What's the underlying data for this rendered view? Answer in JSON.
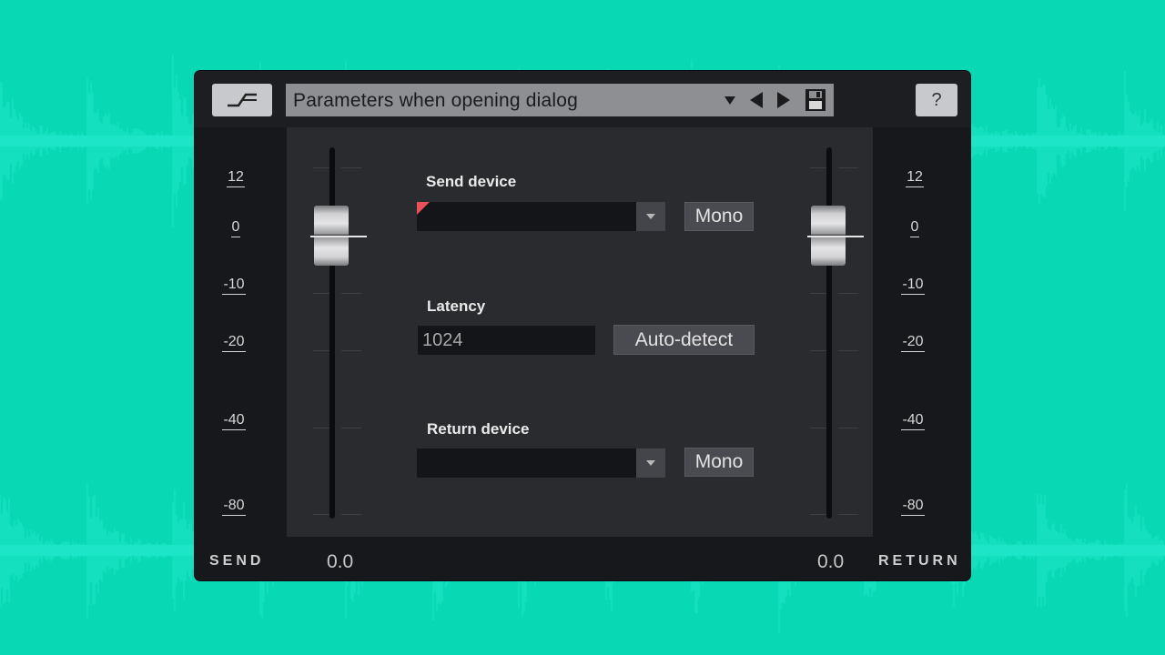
{
  "colors": {
    "background": "#08d8b4",
    "waveform": "#1de6c8",
    "panel": "#17181b",
    "center": "#2a2b2e"
  },
  "icons": {
    "bypass": "bypass-curve-icon",
    "preset_menu": "triangle-down-icon",
    "prev": "arrow-left-icon",
    "next": "arrow-right-icon",
    "save": "save-disk-icon"
  },
  "header": {
    "preset_name": "Parameters when opening dialog",
    "help_label": "?"
  },
  "send": {
    "label": "SEND",
    "value": "0.0",
    "scale": [
      "12",
      "0",
      "-10",
      "-20",
      "-40",
      "-80"
    ]
  },
  "return": {
    "label": "RETURN",
    "value": "0.0",
    "scale": [
      "12",
      "0",
      "-10",
      "-20",
      "-40",
      "-80"
    ]
  },
  "send_device": {
    "label": "Send device",
    "selected": "",
    "mono_label": "Mono"
  },
  "latency": {
    "label": "Latency",
    "value": "1024",
    "auto_detect_label": "Auto-detect"
  },
  "return_device": {
    "label": "Return device",
    "selected": "",
    "mono_label": "Mono"
  }
}
